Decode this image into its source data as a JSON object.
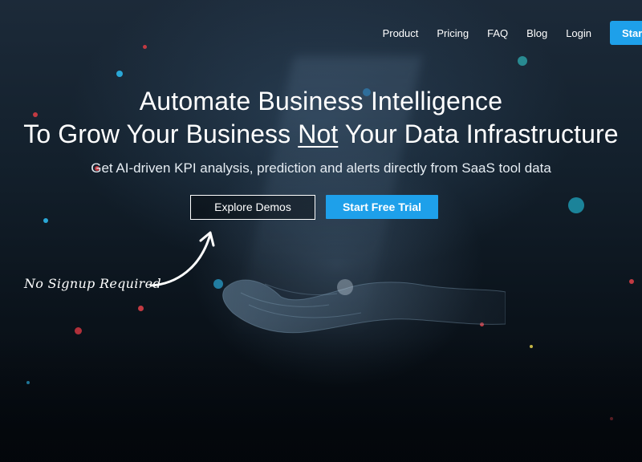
{
  "nav": {
    "links": [
      "Product",
      "Pricing",
      "FAQ",
      "Blog",
      "Login"
    ],
    "cta_label": "Start Free Trial"
  },
  "hero": {
    "title_line1": "Automate Business Intelligence",
    "title_line2_before": "To Grow Your Business ",
    "title_line2_underlined": "Not",
    "title_line2_after": " Your Data Infrastructure",
    "subtitle": "Get AI-driven KPI analysis, prediction and alerts directly from SaaS tool data",
    "explore_button": "Explore Demos",
    "trial_button": "Start Free Trial",
    "note": "No Signup Required"
  },
  "colors": {
    "accent": "#1ea0ea",
    "background": "#0b1118",
    "text": "#ffffff"
  },
  "icons": [
    "hand-illustration",
    "curved-arrow"
  ]
}
